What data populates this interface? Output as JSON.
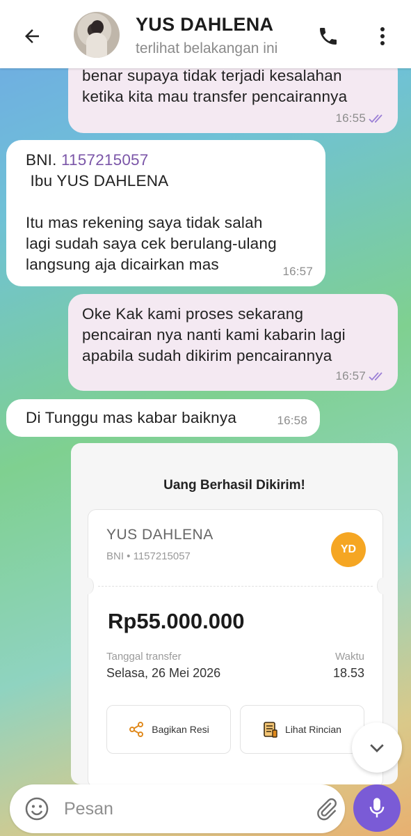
{
  "header": {
    "contact_name": "YUS DAHLENA",
    "status": "terlihat belakangan ini"
  },
  "messages": [
    {
      "direction": "out",
      "lines": [
        "benar supaya tidak terjadi kesalahan",
        "ketika kita mau transfer pencairannya"
      ],
      "time": "16:55",
      "read": true
    },
    {
      "direction": "in",
      "bank": "BNI. ",
      "account": "1157215057",
      "lines": [
        " Ibu YUS DAHLENA",
        "",
        "Itu mas rekening saya tidak salah",
        "lagi sudah saya cek berulang-ulang",
        "langsung aja dicairkan mas"
      ],
      "time": "16:57"
    },
    {
      "direction": "out",
      "lines": [
        "Oke Kak kami proses sekarang",
        "pencairan nya nanti kami kabarin lagi",
        "apabila sudah dikirim pencairannya"
      ],
      "time": "16:57",
      "read": true
    },
    {
      "direction": "in",
      "lines": [
        "Di Tunggu mas kabar baiknya"
      ],
      "time": "16:58"
    }
  ],
  "receipt": {
    "title": "Uang Berhasil Dikirim!",
    "payee_name": "YUS DAHLENA",
    "payee_account": "BNI • 1157215057",
    "initials": "YD",
    "amount": "Rp55.000.000",
    "date_label": "Tanggal transfer",
    "date_value": "Selasa, 26 Mei 2026",
    "time_label": "Waktu",
    "time_value": "18.53",
    "share_label": "Bagikan Resi",
    "details_label": "Lihat Rincian"
  },
  "composer": {
    "placeholder": "Pesan"
  },
  "colors": {
    "outgoing_bubble": "#f4e9f2",
    "incoming_bubble": "#ffffff",
    "accent": "#7a5bd6",
    "read_ticks": "#9b7fd6",
    "badge": "#f5a623"
  },
  "icons": [
    "back-arrow-icon",
    "phone-icon",
    "more-vert-icon",
    "double-check-icon",
    "share-icon",
    "receipt-icon",
    "chevron-down-icon",
    "emoji-icon",
    "paperclip-icon",
    "mic-icon"
  ]
}
